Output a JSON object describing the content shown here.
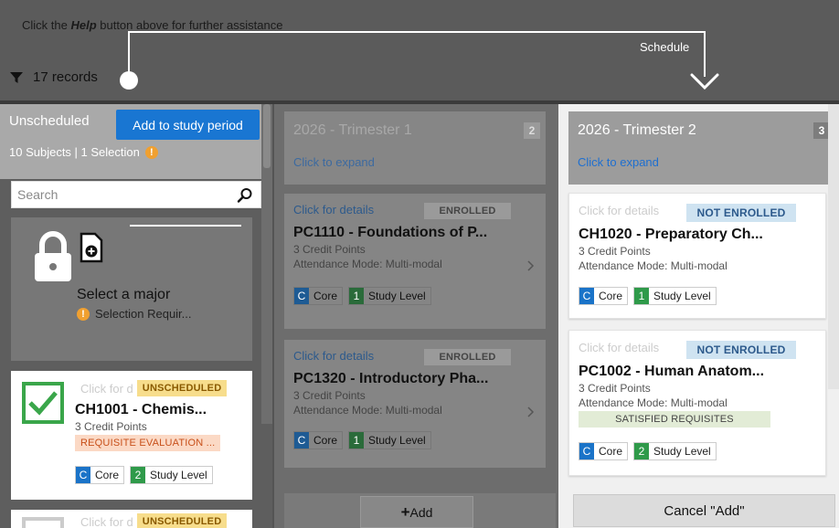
{
  "top": {
    "hint_prefix": "Click the ",
    "hint_bold": "Help",
    "hint_suffix": " button above for further assistance",
    "records_label": "17 records",
    "schedule_label": "Schedule"
  },
  "unscheduled": {
    "title": "Unscheduled",
    "summary": "10 Subjects | 1 Selection",
    "add_button": "Add to study period",
    "search_placeholder": "Search",
    "major_card": {
      "title": "Select a major",
      "subtitle": "Selection Requir..."
    },
    "subject_card": {
      "click_label": "Click for d",
      "status": "UNSCHEDULED",
      "title": "CH1001 - Chemis...",
      "credits": "3 Credit Points",
      "requisite": "REQUISITE EVALUATION ...",
      "tags": [
        {
          "letter": "C",
          "text": "Core"
        },
        {
          "letter": "2",
          "text": "Study Level"
        }
      ]
    },
    "subject_card_2": {
      "click_label": "Click for d",
      "status": "UNSCHEDULED"
    }
  },
  "trimester1": {
    "title": "2026 - Trimester 1",
    "count": "2",
    "expand": "Click to expand",
    "cards": [
      {
        "click_label": "Click for details",
        "status": "ENROLLED",
        "title": "PC1110 - Foundations of P...",
        "credits": "3 Credit Points",
        "attendance": "Attendance Mode: Multi-modal",
        "tags": [
          {
            "letter": "C",
            "text": "Core"
          },
          {
            "letter": "1",
            "text": "Study Level"
          }
        ]
      },
      {
        "click_label": "Click for details",
        "status": "ENROLLED",
        "title": "PC1320 - Introductory Pha...",
        "credits": "3 Credit Points",
        "attendance": "Attendance Mode: Multi-modal",
        "tags": [
          {
            "letter": "C",
            "text": "Core"
          },
          {
            "letter": "1",
            "text": "Study Level"
          }
        ]
      }
    ],
    "add_button": "Add"
  },
  "trimester2": {
    "title": "2026 - Trimester 2",
    "count": "3",
    "expand": "Click to expand",
    "cards": [
      {
        "click_label": "Click for details",
        "status": "NOT ENROLLED",
        "title": "CH1020 - Preparatory Ch...",
        "credits": "3 Credit Points",
        "attendance": "Attendance Mode: Multi-modal",
        "tags": [
          {
            "letter": "C",
            "text": "Core"
          },
          {
            "letter": "1",
            "text": "Study Level"
          }
        ]
      },
      {
        "click_label": "Click for details",
        "status": "NOT ENROLLED",
        "title": "PC1002 - Human Anatom...",
        "credits": "3 Credit Points",
        "attendance": "Attendance Mode: Multi-modal",
        "requisite": "SATISFIED REQUISITES",
        "tags": [
          {
            "letter": "C",
            "text": "Core"
          },
          {
            "letter": "2",
            "text": "Study Level"
          }
        ]
      }
    ],
    "cancel_button": "Cancel \"Add\""
  },
  "icons": [
    "filter-icon",
    "search-icon",
    "lock-icon",
    "document-plus-icon",
    "check-icon",
    "warning-icon",
    "chevron-right-icon",
    "plus-icon",
    "arrow-down-icon"
  ],
  "colors": {
    "primary": "#1976d2",
    "link": "#1e6fd0",
    "core_tag": "#1a73c8",
    "level_tag": "#2f9a4a",
    "warning": "#f0a030"
  }
}
